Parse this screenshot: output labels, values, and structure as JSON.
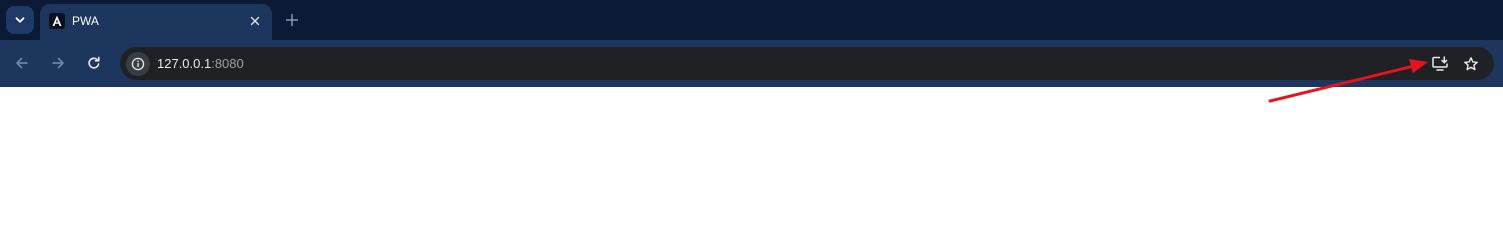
{
  "tabstrip": {
    "search_icon": "chevron-down-icon",
    "tabs": [
      {
        "title": "PWA",
        "favicon": "angular-logo-icon",
        "active": true
      }
    ],
    "new_tab_icon": "plus-icon"
  },
  "toolbar": {
    "back_icon": "arrow-left-icon",
    "forward_icon": "arrow-right-icon",
    "reload_icon": "reload-icon",
    "omnibox": {
      "site_info_icon": "info-icon",
      "url_host": "127.0.0.1",
      "url_port": ":8080"
    },
    "install_icon": "install-app-icon",
    "bookmark_icon": "star-icon"
  },
  "colors": {
    "tabstrip_bg": "#0b1a35",
    "toolbar_bg": "#1c365e",
    "omnibox_bg": "#202124",
    "annotation_arrow": "#e3141b"
  }
}
